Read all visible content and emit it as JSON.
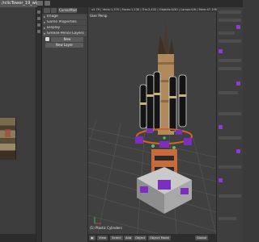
{
  "window": {
    "title": "/rclicTower_19_wip1.blend"
  },
  "props": {
    "header_dropdown": "CursorMaster",
    "panels": [
      {
        "label": "Image",
        "open": false
      },
      {
        "label": "Game Properties",
        "open": false
      },
      {
        "label": "Display",
        "open": false
      },
      {
        "label": "Grease Pencil Layers",
        "open": true
      }
    ],
    "grease_new_label": "New",
    "new_layer_label": "New Layer"
  },
  "viewport": {
    "info_text": "v2.79 | Verts:1,370 | Faces:1,230 | Tris:2,432 | Objects:0/30 | Lamps:0/6 | Mem:47.19M | 30FPS | PlasticCylinders",
    "view_label": "User Persp",
    "object_label": "(1) Plastic Cylinders",
    "footer": {
      "view": "View",
      "select": "Select",
      "add": "Add",
      "object": "Object",
      "mode": "Object Mode",
      "global": "Global"
    }
  },
  "colors": {
    "grid": "#5a5f5a",
    "dark_cylinder": "#141414",
    "wood": "#b08a5a",
    "metal": "#c9c9c9",
    "purple": "#7b2fbf",
    "orange": "#d0632a",
    "green_accent": "#5bbf5b"
  }
}
